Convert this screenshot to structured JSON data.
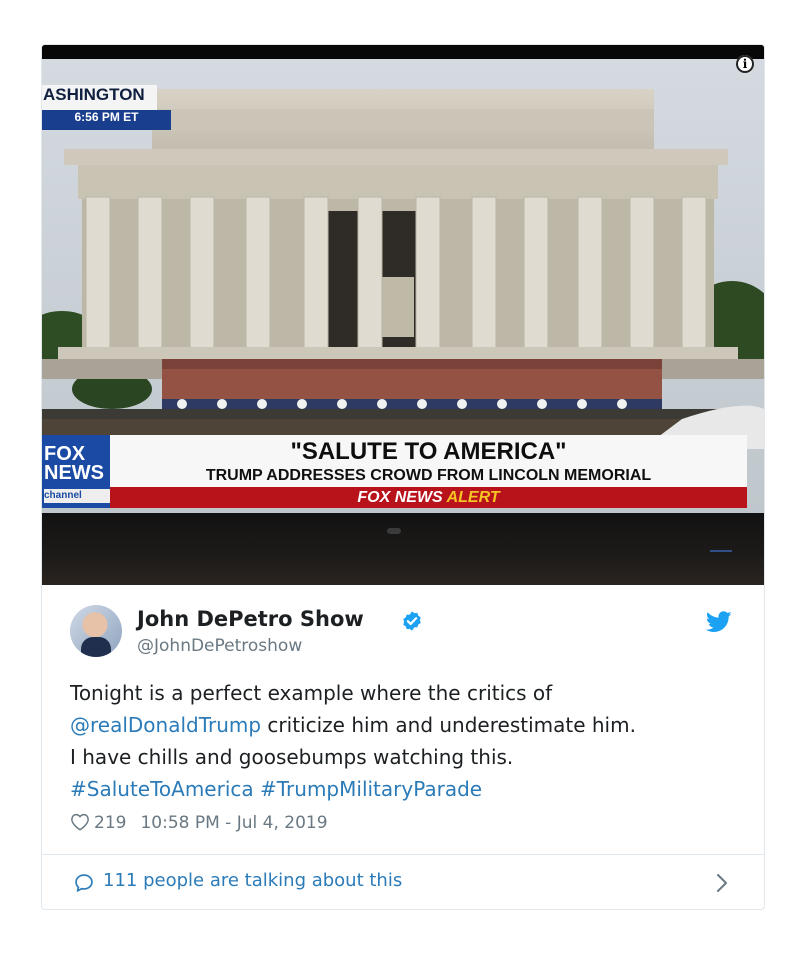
{
  "media": {
    "broadcast_bug": {
      "city": "ASHINGTON",
      "time": "6:56 PM ET"
    },
    "network_logo": {
      "line1": "FOX",
      "line2": "NEWS",
      "line3": "channel"
    },
    "chyron": {
      "headline": "\"SALUTE TO AMERICA\"",
      "subhead": "TRUMP ADDRESSES CROWD FROM LINCOLN MEMORIAL",
      "alert_prefix": "FOX NEWS",
      "alert_word": "ALERT"
    },
    "info_icon": "i"
  },
  "tweet": {
    "author": {
      "name": "John DePetro Show",
      "handle": "@JohnDePetroshow",
      "verified": true
    },
    "text_lines": [
      {
        "plain": "Tonight is a perfect example where the critics of"
      },
      {
        "link": "@realDonaldTrump",
        "plain": " criticize him and underestimate him."
      },
      {
        "plain": "I have chills and goosebumps watching this."
      },
      {
        "link": "#SaluteToAmerica",
        "plain": " ",
        "link2": "#TrumpMilitaryParade"
      }
    ],
    "likes": "219",
    "timestamp": "10:58 PM - Jul 4, 2019",
    "talking": "111 people are talking about this"
  },
  "colors": {
    "link": "#2b7bb9",
    "muted": "#697882",
    "twitter_blue": "#1da1f2",
    "fox_blue": "#1a4aa3",
    "alert_red": "#b8121b",
    "alert_yellow": "#f4c524"
  },
  "icons": [
    "info-icon",
    "verified-icon",
    "twitter-bird-icon",
    "heart-icon",
    "reply-icon",
    "chevron-right-icon"
  ]
}
